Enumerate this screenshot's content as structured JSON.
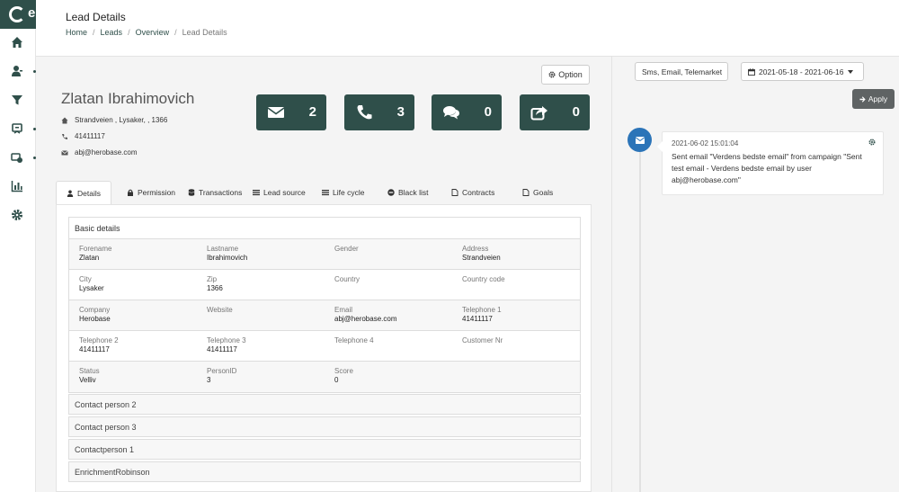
{
  "app": {
    "logo_letter": "e"
  },
  "header": {
    "title": "Lead Details",
    "breadcrumb": [
      "Home",
      "Leads",
      "Overview",
      "Lead Details"
    ]
  },
  "lead": {
    "option_label": "Option",
    "name": "Zlatan Ibrahimovich",
    "address": "Strandveien , Lysaker, , 1366",
    "phone": "41411117",
    "email": "abj@herobase.com"
  },
  "stats": [
    {
      "icon": "envelope-icon",
      "count": "2"
    },
    {
      "icon": "phone-icon",
      "count": "3"
    },
    {
      "icon": "comments-icon",
      "count": "0"
    },
    {
      "icon": "share-icon",
      "count": "0"
    }
  ],
  "tabs": [
    {
      "label": "Details",
      "icon": "user-icon"
    },
    {
      "label": "Permission",
      "icon": "lock-icon"
    },
    {
      "label": "Transactions",
      "icon": "database-icon"
    },
    {
      "label": "Lead source",
      "icon": "list-icon"
    },
    {
      "label": "Life cycle",
      "icon": "list-icon"
    },
    {
      "label": "Black list",
      "icon": "minus-circle-icon"
    },
    {
      "label": "Contracts",
      "icon": "file-icon"
    },
    {
      "label": "Goals",
      "icon": "file-icon"
    }
  ],
  "basic_details": {
    "title": "Basic details",
    "rows": [
      [
        {
          "label": "Forename",
          "value": "Zlatan"
        },
        {
          "label": "Lastname",
          "value": "Ibrahimovich"
        },
        {
          "label": "Gender",
          "value": ""
        },
        {
          "label": "Address",
          "value": "Strandveien"
        }
      ],
      [
        {
          "label": "City",
          "value": "Lysaker"
        },
        {
          "label": "Zip",
          "value": "1366"
        },
        {
          "label": "Country",
          "value": ""
        },
        {
          "label": "Country code",
          "value": ""
        }
      ],
      [
        {
          "label": "Company",
          "value": "Herobase"
        },
        {
          "label": "Website",
          "value": ""
        },
        {
          "label": "Email",
          "value": "abj@herobase.com"
        },
        {
          "label": "Telephone 1",
          "value": "41411117"
        }
      ],
      [
        {
          "label": "Telephone 2",
          "value": "41411117"
        },
        {
          "label": "Telephone 3",
          "value": "41411117"
        },
        {
          "label": "Telephone 4",
          "value": ""
        },
        {
          "label": "Customer Nr",
          "value": ""
        }
      ],
      [
        {
          "label": "Status",
          "value": "Velliv"
        },
        {
          "label": "PersonID",
          "value": "3"
        },
        {
          "label": "Score",
          "value": "0"
        },
        {
          "label": "",
          "value": ""
        }
      ]
    ]
  },
  "sections": [
    "Contact person 2",
    "Contact person 3",
    "Contactperson 1",
    "EnrichmentRobinson"
  ],
  "filters": {
    "channels": "Sms, Email, Telemarket",
    "date_range": "2021-05-18 - 2021-06-16",
    "apply_label": "Apply"
  },
  "timeline": [
    {
      "time": "2021-06-02 15:01:04",
      "text": "Sent email \"Verdens bedste email\" from campaign \"Sent test email - Verdens bedste email by user abj@herobase.com\""
    }
  ]
}
